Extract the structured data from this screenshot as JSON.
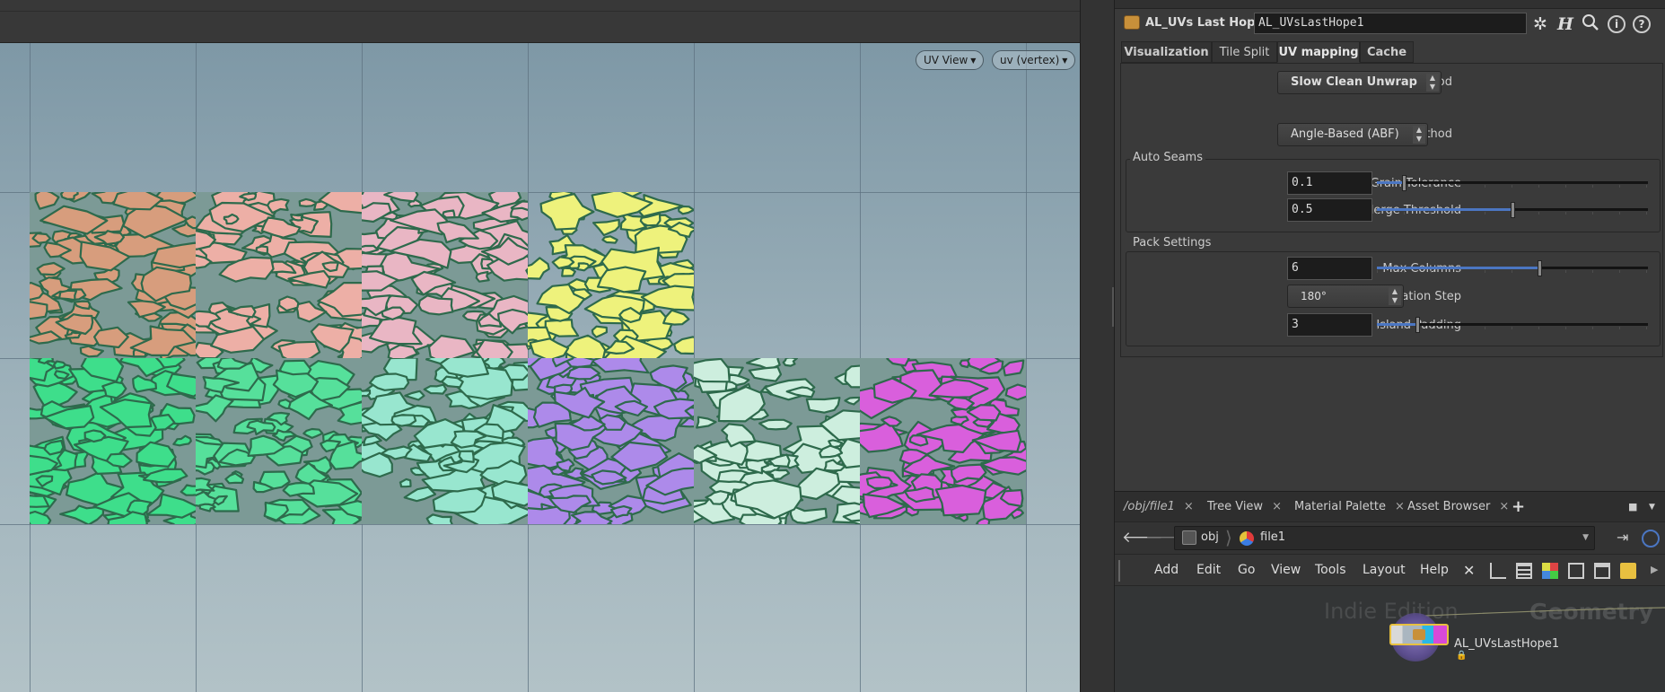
{
  "viewport": {
    "view_dropdown": "UV View",
    "attrib_dropdown": "uv (vertex)"
  },
  "tiles": [
    {
      "row": 0,
      "col": 0,
      "color": "#d79d7d"
    },
    {
      "row": 0,
      "col": 1,
      "color": "#edafa6"
    },
    {
      "row": 0,
      "col": 2,
      "color": "#e9b6c4"
    },
    {
      "row": 0,
      "col": 3,
      "color": "#eef27c"
    },
    {
      "row": 1,
      "col": 0,
      "color": "#3ede8b"
    },
    {
      "row": 1,
      "col": 1,
      "color": "#56e09b"
    },
    {
      "row": 1,
      "col": 2,
      "color": "#98e6cf"
    },
    {
      "row": 1,
      "col": 3,
      "color": "#ad8aea"
    },
    {
      "row": 1,
      "col": 4,
      "color": "#cdeede"
    },
    {
      "row": 1,
      "col": 5,
      "color": "#d95fdc"
    }
  ],
  "param": {
    "node_type": "AL_UVs Last Hope",
    "node_name": "AL_UVsLastHope1",
    "tabs": [
      "Visualization",
      "Tile Split",
      "UV mapping",
      "Cache"
    ],
    "uv_method": {
      "label": "UV Method",
      "value": "Slow Clean Unwrap"
    },
    "flattening": {
      "label": "Flattening Method",
      "value": "Angle-Based (ABF)"
    },
    "auto_seams": {
      "title": "Auto Seams",
      "grain_label": "Grain Tolerance",
      "grain_value": "0.1",
      "grain_level": 0.1,
      "merge_label": "Merge Threshold",
      "merge_value": "0.5",
      "merge_level": 0.5
    },
    "pack": {
      "title": "Pack Settings",
      "cols_label": "Max Columns",
      "cols_value": "6",
      "cols_level": 0.6,
      "rot_label": "Island Rotation Step",
      "rot_value": "180°",
      "pad_label": "Island Padding",
      "pad_value": "3",
      "pad_level": 0.15
    }
  },
  "network": {
    "tabs": [
      "/obj/file1",
      "Tree View",
      "Material Palette",
      "Asset Browser"
    ],
    "add_tab": "+",
    "path": [
      "obj",
      "file1"
    ],
    "menus": [
      "Add",
      "Edit",
      "Go",
      "View",
      "Tools",
      "Layout",
      "Help"
    ],
    "watermark_edition": "Indie Edition",
    "watermark_context": "Geometry",
    "node_label": "AL_UVsLastHope1"
  },
  "colors": {
    "accent_blue": "#4b76c2",
    "node_selected": "#e8c040",
    "island_outline": "#2e6a4c"
  }
}
